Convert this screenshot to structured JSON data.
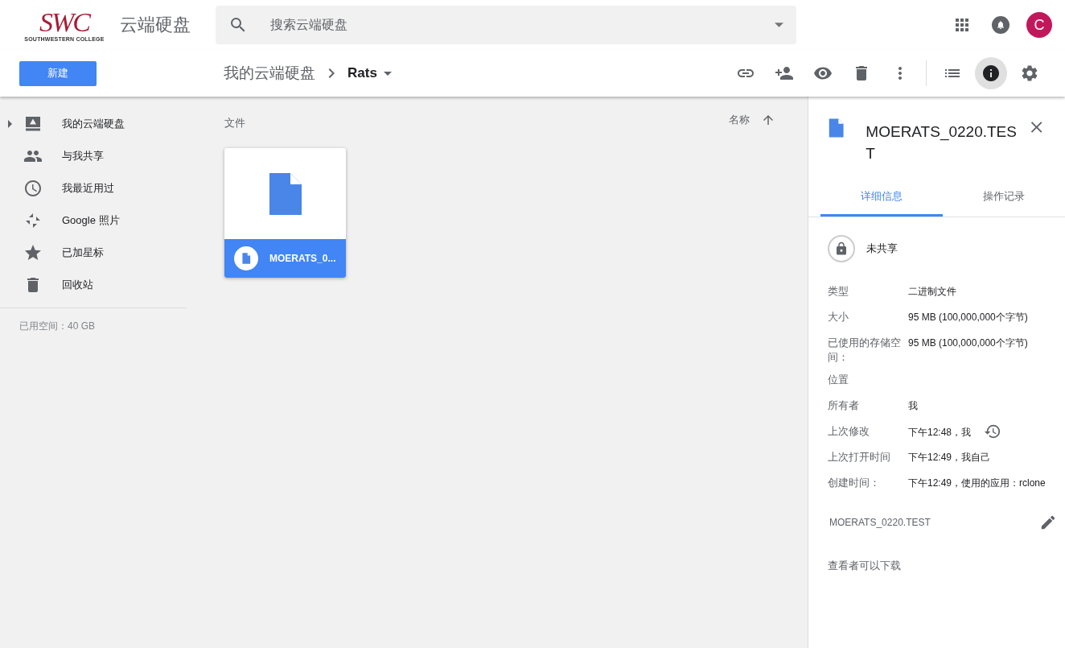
{
  "header": {
    "logo": {
      "mark": "SWC",
      "tagline": "SOUTHWESTERN COLLEGE"
    },
    "app_title": "云端硬盘",
    "search": {
      "placeholder": "搜索云端硬盘"
    },
    "avatar": "C"
  },
  "new_button": "新建",
  "breadcrumb": [
    {
      "label": "我的云端硬盘",
      "current": false
    },
    {
      "label": "Rats",
      "current": true
    }
  ],
  "toolbar_buttons": [
    {
      "kind": "link",
      "selected": false
    },
    {
      "kind": "share",
      "selected": false
    },
    {
      "kind": "preview",
      "selected": false
    },
    {
      "kind": "delete",
      "selected": false
    },
    {
      "kind": "more",
      "selected": false
    },
    {
      "kind": "list",
      "selected": false
    },
    {
      "kind": "info",
      "selected": true
    },
    {
      "kind": "settings",
      "selected": false
    }
  ],
  "sidebar": {
    "items": [
      {
        "label": "我的云端硬盘",
        "kind": "drive",
        "expandable": true
      },
      {
        "label": "与我共享",
        "kind": "shared",
        "expandable": false
      },
      {
        "label": "我最近用过",
        "kind": "recent",
        "expandable": false
      },
      {
        "label": "Google 照片",
        "kind": "photos",
        "expandable": false
      },
      {
        "label": "已加星标",
        "kind": "starred",
        "expandable": false
      },
      {
        "label": "回收站",
        "kind": "trash",
        "expandable": false
      }
    ],
    "storage": "已用空间：40 GB"
  },
  "files": {
    "section": "文件",
    "sort_label": "名称",
    "items": [
      {
        "name": "MOERATS_0...",
        "selected": true
      }
    ]
  },
  "details": {
    "title": "MOERATS_0220.TEST",
    "tabs": [
      {
        "label": "详细信息",
        "selected": true
      },
      {
        "label": "操作记录",
        "selected": false
      }
    ],
    "sharing": "未共享",
    "rows": [
      {
        "label": "类型",
        "value": "二进制文件",
        "kind": "plain"
      },
      {
        "label": "大小",
        "value": "95 MB (100,000,000个字节)",
        "kind": "plain"
      },
      {
        "label": "已使用的存储空间：",
        "value": "95 MB (100,000,000个字节)",
        "kind": "plain"
      },
      {
        "label": "位置",
        "kind": "plain"
      },
      {
        "label": "所有者",
        "value": "我",
        "kind": "plain"
      },
      {
        "label": "上次修改",
        "value": "下午12:48，我",
        "kind": "history"
      },
      {
        "label": "上次打开时间",
        "value": "下午12:49，我自己",
        "kind": "plain"
      },
      {
        "label": "创建时间：",
        "value": "下午12:49，使用的应用：rclone",
        "kind": "plain"
      }
    ],
    "description": "MOERATS_0220.TEST",
    "download_note": "查看者可以下载"
  }
}
